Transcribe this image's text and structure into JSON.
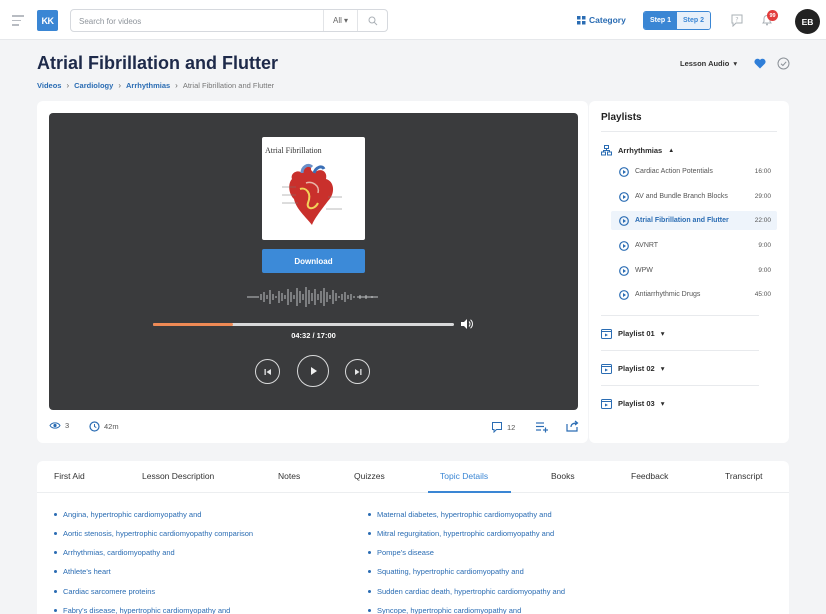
{
  "topbar": {
    "logo_text": "KK",
    "search_placeholder": "Search for videos",
    "search_filter": "All",
    "category_label": "Category",
    "steps": [
      "Step 1",
      "Step 2"
    ],
    "notification_count": "99",
    "avatar_initials": "EB"
  },
  "header": {
    "title": "Atrial Fibrillation and Flutter",
    "breadcrumb": [
      "Videos",
      "Cardiology",
      "Arrhythmias",
      "Atrial Fibrillation and Flutter"
    ],
    "lesson_audio_label": "Lesson Audio",
    "favorite_color": "#2f7ed8"
  },
  "player": {
    "cover_title": "Atrial Fibrillation",
    "download_label": "Download",
    "time_display": "04:32 / 17:00",
    "progress_fraction": 0.267,
    "progress_color": "#ef8a55"
  },
  "meta": {
    "views": "3",
    "duration": "42m",
    "comments": "12"
  },
  "playlists": {
    "heading": "Playlists",
    "open_group": "Arrhythmias",
    "items": [
      {
        "title": "Cardiac Action Potentials",
        "duration": "16:00"
      },
      {
        "title": "AV and Bundle Branch Blocks",
        "duration": "29:00"
      },
      {
        "title": "Atrial Fibrillation and Flutter",
        "duration": "22:00"
      },
      {
        "title": "AVNRT",
        "duration": "9:00"
      },
      {
        "title": "WPW",
        "duration": "9:00"
      },
      {
        "title": "Antiarrhythmic Drugs",
        "duration": "45:00"
      }
    ],
    "active_index": 2,
    "collapsed_groups": [
      "Playlist 01",
      "Playlist 02",
      "Playlist 03"
    ]
  },
  "tabs": {
    "items": [
      "First Aid",
      "Lesson Description",
      "Notes",
      "Quizzes",
      "Topic Details",
      "Books",
      "Feedback",
      "Transcript"
    ],
    "active": "Topic Details"
  },
  "topics": {
    "left": [
      "Angina, hypertrophic cardiomyopathy and",
      "Aortic stenosis, hypertrophic cardiomyopathy comparison",
      "Arrhythmias, cardiomyopathy and",
      "Athlete's heart",
      "Cardiac sarcomere proteins",
      "Fabry's disease, hypertrophic cardiomyopathy and"
    ],
    "right": [
      "Maternal diabetes, hypertrophic cardiomyopathy and",
      "Mitral regurgitation, hypertrophic cardiomyopathy and",
      "Pompe's disease",
      "Squatting, hypertrophic cardiomyopathy and",
      "Sudden cardiac death, hypertrophic cardiomyopathy and",
      "Syncope, hypertrophic cardiomyopathy and"
    ]
  }
}
